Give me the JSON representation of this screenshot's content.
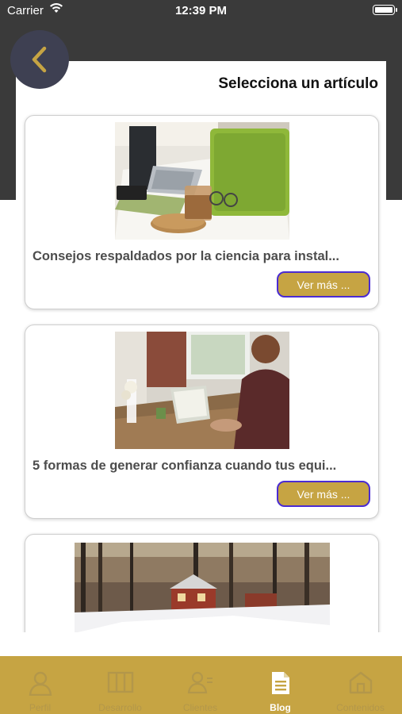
{
  "status_bar": {
    "carrier": "Carrier",
    "time": "12:39 PM"
  },
  "header": {
    "title": "Selecciona un artículo",
    "back_icon": "chevron-left-icon"
  },
  "articles": [
    {
      "title": "Consejos respaldados por la ciencia para instal...",
      "button_label": "Ver más ..."
    },
    {
      "title": "5 formas de generar confianza cuando tus equi...",
      "button_label": "Ver más ..."
    },
    {
      "title": "",
      "button_label": ""
    }
  ],
  "tab_bar": {
    "items": [
      {
        "label": "Perfil",
        "icon": "person-icon",
        "active": false
      },
      {
        "label": "Desarrollo",
        "icon": "book-icon",
        "active": false
      },
      {
        "label": "Clientes",
        "icon": "users-icon",
        "active": false
      },
      {
        "label": "Blog",
        "icon": "document-icon",
        "active": true
      },
      {
        "label": "Contenidos",
        "icon": "home-icon",
        "active": false
      }
    ]
  },
  "colors": {
    "accent": "#c6a443",
    "dark": "#3a3a3a",
    "button_border": "#4a2bd2",
    "back_button": "#3e4052"
  }
}
